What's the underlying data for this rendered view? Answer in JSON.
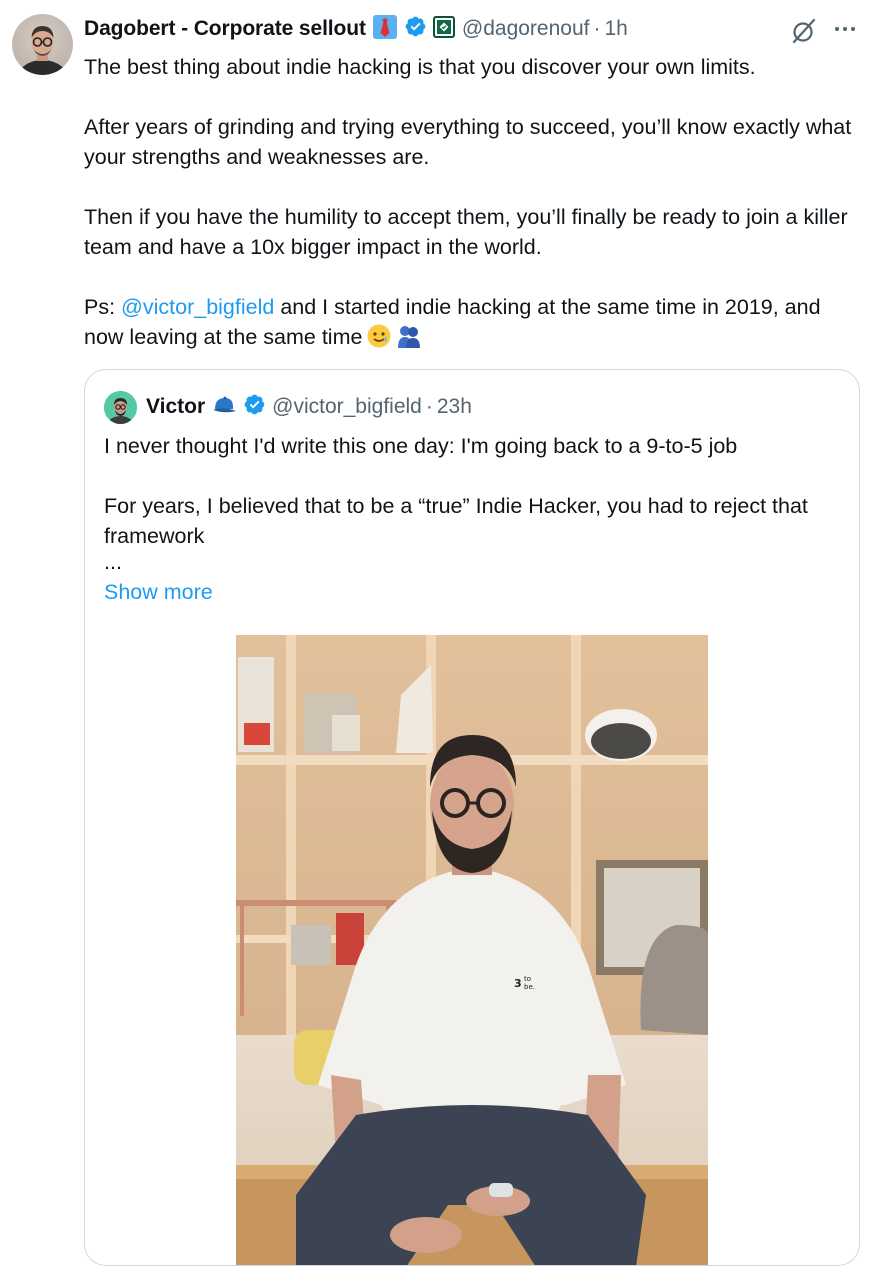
{
  "tweet": {
    "author": {
      "display_name": "Dagobert - Corporate sellout",
      "handle": "@dagorenouf",
      "time": "1h"
    },
    "separator": "·",
    "paragraphs": [
      "The best thing about indie hacking is that you discover your own limits.",
      "After years of grinding and trying everything to succeed, you’ll know exactly what your strengths and weaknesses are.",
      "Then if you have the humility to accept them, you’ll finally be ready to join a killer team and have a 10x bigger impact in the world."
    ],
    "ps_prefix": "Ps: ",
    "ps_mention": "@victor_bigfield",
    "ps_rest": " and I started indie hacking at the same time in 2019, and now leaving at the same time",
    "icons": {
      "grok": "grok-icon",
      "more": "more-icon",
      "verified": "verified-badge-icon",
      "affiliate": "affiliate-badge-icon",
      "tie_emoji": "necktie-emoji-icon",
      "smile_tear_emoji": "smiling-face-with-tear-emoji-icon",
      "people_hug_emoji": "people-hugging-emoji-icon"
    }
  },
  "quote": {
    "author": {
      "display_name": "Victor",
      "handle": "@victor_bigfield",
      "time": "23h"
    },
    "separator": "·",
    "line1": "I never thought I'd write this one day: I'm going back to a 9-to-5 job",
    "line2": "For years, I believed that to be a “true” Indie Hacker, you had to reject that framework",
    "ellipsis": "...",
    "show_more": "Show more",
    "icons": {
      "cap_emoji": "billed-cap-emoji-icon",
      "verified": "verified-badge-icon"
    },
    "photo_alt": "photo"
  },
  "colors": {
    "link": "#1d9bf0",
    "text": "#0f1419",
    "secondary": "#536471",
    "border": "#cfd9de",
    "verified": "#1d9bf0"
  }
}
